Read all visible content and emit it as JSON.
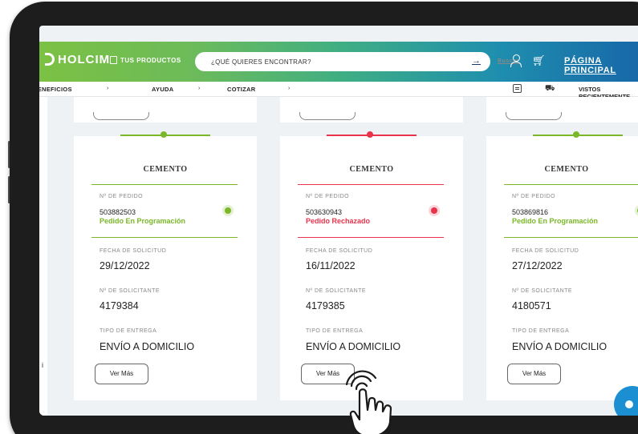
{
  "header": {
    "logo": "HOLCIM",
    "products_link": "TUS PRODUCTOS",
    "search_placeholder": "¿QUÉ QUIERES ENCONTRAR?",
    "search_button": "Buscar",
    "main_page_link": "PÁGINA PRINCIPAL",
    "icons": [
      "box-icon",
      "user-icon",
      "cart-icon",
      "search-arrow-icon"
    ]
  },
  "nav": {
    "items": [
      "BENEFICIOS",
      "AYUDA",
      "COTIZAR"
    ],
    "recent": "VISTOS RECIENTEMENTE",
    "icons": [
      "document-icon",
      "truck-icon"
    ]
  },
  "side_marker": "i",
  "orders": [
    {
      "title": "CEMENTO",
      "order_label": "Nº DE PEDIDO",
      "order_number": "503882503",
      "status": "Pedido En Programación",
      "status_color": "#7ab829",
      "date_label": "FECHA DE SOLICITUD",
      "date": "29/12/2022",
      "applicant_label": "Nº DE SOLICITANTE",
      "applicant": "4179384",
      "delivery_label": "TIPO DE ENTREGA",
      "delivery": "ENVÍO A DOMICILIO",
      "button": "Ver Más"
    },
    {
      "title": "CEMENTO",
      "order_label": "Nº DE PEDIDO",
      "order_number": "503630943",
      "status": "Pedido Rechazado",
      "status_color": "#e8334a",
      "date_label": "FECHA DE SOLICITUD",
      "date": "16/11/2022",
      "applicant_label": "Nº DE SOLICITANTE",
      "applicant": "4179385",
      "delivery_label": "TIPO DE ENTREGA",
      "delivery": "ENVÍO A DOMICILIO",
      "button": "Ver Más"
    },
    {
      "title": "CEMENTO",
      "order_label": "Nº DE PEDIDO",
      "order_number": "503869816",
      "status": "Pedido En Programación",
      "status_color": "#7ab829",
      "date_label": "FECHA DE SOLICITUD",
      "date": "27/12/2022",
      "applicant_label": "Nº DE SOLICITANTE",
      "applicant": "4180571",
      "delivery_label": "TIPO DE ENTREGA",
      "delivery": "ENVÍO A DOMICILIO",
      "button": "Ver Más"
    }
  ],
  "colors": {
    "green": "#7ab829",
    "red": "#e8334a",
    "header_gradient_start": "#7bc143",
    "header_gradient_end": "#1766a8",
    "chat": "#1b8fd1"
  }
}
